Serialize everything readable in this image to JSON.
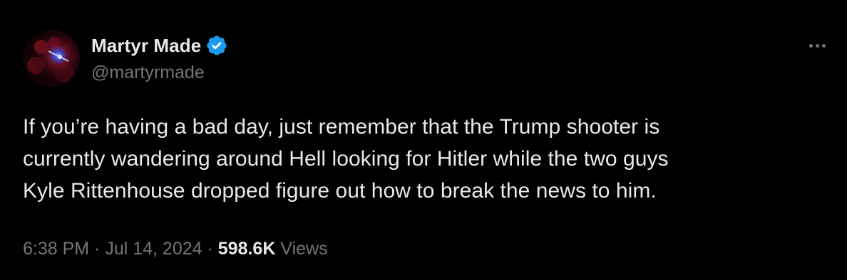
{
  "author": {
    "display_name": "Martyr Made",
    "handle": "@martyrmade",
    "avatar_icon": "avatar-image",
    "verified_icon": "verified-badge-icon",
    "verified_color": "#1d9bf0"
  },
  "menu": {
    "icon": "more-options-icon"
  },
  "tweet": {
    "lines": [
      "If you’re having a bad day, just remember that the Trump shooter is",
      "currently wandering around Hell looking for Hitler while the two guys",
      "Kyle Rittenhouse dropped figure out how to break the news to him."
    ]
  },
  "meta": {
    "time": "6:38 PM",
    "separator": " · ",
    "date": "Jul 14, 2024",
    "views_count": "598.6K",
    "views_label": "Views"
  },
  "colors": {
    "background": "#000000",
    "primary_text": "#e7e9ea",
    "secondary_text": "#71767b",
    "accent": "#1d9bf0"
  }
}
